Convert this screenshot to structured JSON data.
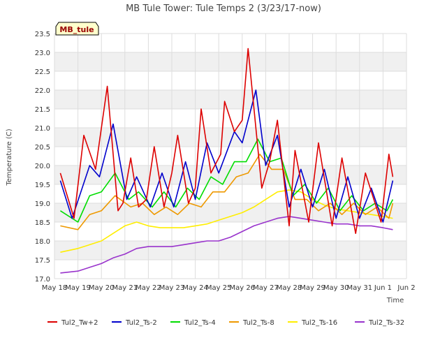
{
  "chart_data": {
    "type": "line",
    "title": "MB Tule Tower: Tule Temps 2 (3/23/17-now)",
    "xlabel": "Time",
    "ylabel": "Temperature (C)",
    "station_label": "MB_tule",
    "xlim": [
      "2017-05-18",
      "2017-06-02"
    ],
    "ylim": [
      17.0,
      23.5
    ],
    "x_ticks": [
      "May 18",
      "May 19",
      "May 20",
      "May 21",
      "May 22",
      "May 23",
      "May 24",
      "May 25",
      "May 26",
      "May 27",
      "May 28",
      "May 29",
      "May 30",
      "May 31",
      "Jun 1",
      "Jun 2"
    ],
    "y_ticks": [
      "17.0",
      "17.5",
      "18.0",
      "18.5",
      "19.0",
      "19.5",
      "20.0",
      "20.5",
      "21.0",
      "21.5",
      "22.0",
      "22.5",
      "23.0",
      "23.5"
    ],
    "grid": "horizontal bands",
    "legend_position": "bottom",
    "series": [
      {
        "name": "Tul2_Tw+2",
        "color": "#dd0000",
        "x": [
          "2017-05-18T06:00",
          "2017-05-18T20:00",
          "2017-05-19T06:00",
          "2017-05-19T18:00",
          "2017-05-20T06:00",
          "2017-05-20T17:00",
          "2017-05-20T22:00",
          "2017-05-21T06:00",
          "2017-05-21T14:00",
          "2017-05-21T22:00",
          "2017-05-22T06:00",
          "2017-05-22T16:00",
          "2017-05-23T00:00",
          "2017-05-23T06:00",
          "2017-05-23T17:00",
          "2017-05-24T00:00",
          "2017-05-24T06:00",
          "2017-05-24T16:00",
          "2017-05-25T02:00",
          "2017-05-25T06:00",
          "2017-05-25T16:00",
          "2017-05-26T00:00",
          "2017-05-26T06:00",
          "2017-05-26T20:00",
          "2017-05-27T04:00",
          "2017-05-27T12:00",
          "2017-05-28T00:00",
          "2017-05-28T06:00",
          "2017-05-28T20:00",
          "2017-05-29T06:00",
          "2017-05-29T20:00",
          "2017-05-30T06:00",
          "2017-05-30T20:00",
          "2017-05-31T06:00",
          "2017-05-31T22:00",
          "2017-06-01T06:00",
          "2017-06-01T10:00"
        ],
        "values": [
          19.8,
          18.6,
          20.8,
          19.9,
          22.1,
          18.8,
          19.0,
          20.2,
          18.9,
          19.1,
          20.5,
          18.9,
          19.8,
          20.8,
          19.0,
          19.4,
          21.5,
          19.8,
          20.3,
          21.7,
          20.9,
          21.2,
          23.1,
          19.4,
          20.1,
          21.2,
          18.4,
          20.4,
          18.5,
          20.6,
          18.4,
          20.2,
          18.2,
          19.8,
          18.5,
          20.3,
          19.7
        ]
      },
      {
        "name": "Tul2_Ts-2",
        "color": "#0000cc",
        "x": [
          "2017-05-18T06:00",
          "2017-05-18T18:00",
          "2017-05-19T12:00",
          "2017-05-19T22:00",
          "2017-05-20T12:00",
          "2017-05-21T02:00",
          "2017-05-21T12:00",
          "2017-05-22T02:00",
          "2017-05-22T14:00",
          "2017-05-23T02:00",
          "2017-05-23T14:00",
          "2017-05-24T00:00",
          "2017-05-24T12:00",
          "2017-05-25T00:00",
          "2017-05-25T16:00",
          "2017-05-26T00:00",
          "2017-05-26T14:00",
          "2017-05-27T00:00",
          "2017-05-27T12:00",
          "2017-05-28T00:00",
          "2017-05-28T12:00",
          "2017-05-29T00:00",
          "2017-05-29T12:00",
          "2017-05-30T00:00",
          "2017-05-30T12:00",
          "2017-05-31T00:00",
          "2017-05-31T12:00",
          "2017-06-01T00:00",
          "2017-06-01T10:00"
        ],
        "values": [
          19.6,
          18.6,
          20.0,
          19.7,
          21.1,
          19.1,
          19.7,
          18.9,
          19.8,
          18.9,
          20.1,
          19.1,
          20.6,
          19.8,
          20.9,
          20.6,
          22.0,
          20.0,
          20.8,
          18.9,
          19.9,
          18.9,
          19.9,
          18.6,
          19.7,
          18.6,
          19.4,
          18.5,
          19.6
        ]
      },
      {
        "name": "Tul2_Ts-4",
        "color": "#00dd00",
        "x": [
          "2017-05-18T06:00",
          "2017-05-19T00:00",
          "2017-05-19T12:00",
          "2017-05-20T00:00",
          "2017-05-20T14:00",
          "2017-05-21T04:00",
          "2017-05-21T14:00",
          "2017-05-22T04:00",
          "2017-05-22T16:00",
          "2017-05-23T04:00",
          "2017-05-23T16:00",
          "2017-05-24T04:00",
          "2017-05-24T16:00",
          "2017-05-25T04:00",
          "2017-05-25T16:00",
          "2017-05-26T04:00",
          "2017-05-26T16:00",
          "2017-05-27T04:00",
          "2017-05-27T16:00",
          "2017-05-28T04:00",
          "2017-05-28T16:00",
          "2017-05-29T04:00",
          "2017-05-29T16:00",
          "2017-05-30T04:00",
          "2017-05-30T16:00",
          "2017-05-31T04:00",
          "2017-05-31T16:00",
          "2017-06-01T04:00",
          "2017-06-01T10:00"
        ],
        "values": [
          18.8,
          18.5,
          19.2,
          19.3,
          19.8,
          19.1,
          19.3,
          18.9,
          19.3,
          18.9,
          19.4,
          19.1,
          19.7,
          19.5,
          20.1,
          20.1,
          20.7,
          20.1,
          20.2,
          19.2,
          19.5,
          19.0,
          19.4,
          18.8,
          19.2,
          18.8,
          19.0,
          18.8,
          19.1
        ]
      },
      {
        "name": "Tul2_Ts-8",
        "color": "#ee9900",
        "x": [
          "2017-05-18T06:00",
          "2017-05-19T00:00",
          "2017-05-19T12:00",
          "2017-05-20T00:00",
          "2017-05-20T14:00",
          "2017-05-21T06:00",
          "2017-05-21T18:00",
          "2017-05-22T06:00",
          "2017-05-22T18:00",
          "2017-05-23T06:00",
          "2017-05-23T18:00",
          "2017-05-24T06:00",
          "2017-05-24T18:00",
          "2017-05-25T06:00",
          "2017-05-25T18:00",
          "2017-05-26T06:00",
          "2017-05-26T18:00",
          "2017-05-27T06:00",
          "2017-05-27T18:00",
          "2017-05-28T06:00",
          "2017-05-28T18:00",
          "2017-05-29T06:00",
          "2017-05-29T18:00",
          "2017-05-30T06:00",
          "2017-05-30T18:00",
          "2017-05-31T06:00",
          "2017-05-31T18:00",
          "2017-06-01T06:00",
          "2017-06-01T10:00"
        ],
        "values": [
          18.4,
          18.3,
          18.7,
          18.8,
          19.2,
          18.9,
          19.0,
          18.7,
          18.9,
          18.7,
          19.0,
          18.9,
          19.3,
          19.3,
          19.7,
          19.8,
          20.3,
          19.9,
          19.9,
          19.1,
          19.1,
          18.8,
          19.0,
          18.7,
          19.0,
          18.7,
          18.9,
          18.6,
          19.0
        ]
      },
      {
        "name": "Tul2_Ts-16",
        "color": "#ffee00",
        "x": [
          "2017-05-18T06:00",
          "2017-05-19T00:00",
          "2017-05-19T12:00",
          "2017-05-20T00:00",
          "2017-05-20T12:00",
          "2017-05-21T00:00",
          "2017-05-21T12:00",
          "2017-05-22T00:00",
          "2017-05-22T12:00",
          "2017-05-23T00:00",
          "2017-05-23T12:00",
          "2017-05-24T00:00",
          "2017-05-24T12:00",
          "2017-05-25T00:00",
          "2017-05-25T12:00",
          "2017-05-26T00:00",
          "2017-05-26T12:00",
          "2017-05-27T00:00",
          "2017-05-27T12:00",
          "2017-05-28T00:00",
          "2017-05-28T12:00",
          "2017-05-29T00:00",
          "2017-05-29T12:00",
          "2017-05-30T00:00",
          "2017-05-30T12:00",
          "2017-05-31T00:00",
          "2017-05-31T12:00",
          "2017-06-01T00:00",
          "2017-06-01T10:00"
        ],
        "values": [
          17.7,
          17.8,
          17.9,
          18.0,
          18.2,
          18.4,
          18.5,
          18.4,
          18.35,
          18.35,
          18.35,
          18.4,
          18.45,
          18.55,
          18.65,
          18.75,
          18.9,
          19.1,
          19.3,
          19.35,
          19.3,
          19.1,
          18.95,
          18.85,
          18.8,
          18.75,
          18.7,
          18.65,
          18.6
        ]
      },
      {
        "name": "Tul2_Ts-32",
        "color": "#9933cc",
        "x": [
          "2017-05-18T06:00",
          "2017-05-19T00:00",
          "2017-05-19T12:00",
          "2017-05-20T00:00",
          "2017-05-20T12:00",
          "2017-05-21T00:00",
          "2017-05-21T12:00",
          "2017-05-22T00:00",
          "2017-05-22T12:00",
          "2017-05-23T00:00",
          "2017-05-23T12:00",
          "2017-05-24T00:00",
          "2017-05-24T12:00",
          "2017-05-25T00:00",
          "2017-05-25T12:00",
          "2017-05-26T00:00",
          "2017-05-26T12:00",
          "2017-05-27T00:00",
          "2017-05-27T12:00",
          "2017-05-28T00:00",
          "2017-05-28T12:00",
          "2017-05-29T00:00",
          "2017-05-29T12:00",
          "2017-05-30T00:00",
          "2017-05-30T12:00",
          "2017-05-31T00:00",
          "2017-05-31T12:00",
          "2017-06-01T00:00",
          "2017-06-01T10:00"
        ],
        "values": [
          17.15,
          17.2,
          17.3,
          17.4,
          17.55,
          17.65,
          17.8,
          17.85,
          17.85,
          17.85,
          17.9,
          17.95,
          18.0,
          18.0,
          18.1,
          18.25,
          18.4,
          18.5,
          18.6,
          18.65,
          18.6,
          18.55,
          18.5,
          18.45,
          18.45,
          18.4,
          18.4,
          18.35,
          18.3
        ]
      }
    ]
  }
}
